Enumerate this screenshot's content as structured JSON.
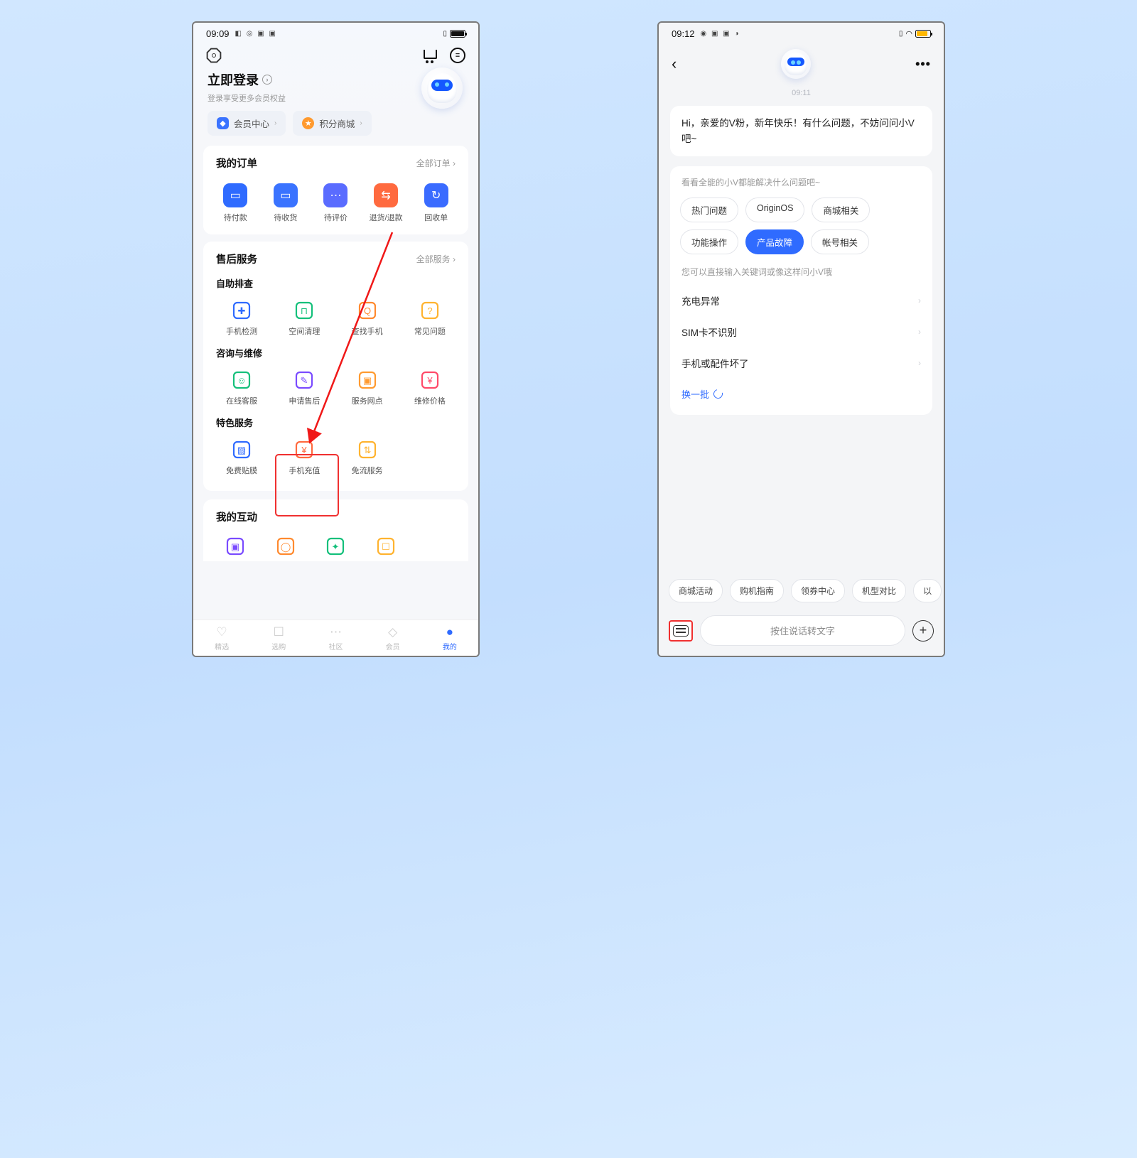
{
  "screen1": {
    "status": {
      "time": "09:09",
      "glyphs": "◧ ◎ ▣ ▣"
    },
    "login": {
      "title": "立即登录",
      "sub": "登录享受更多会员权益"
    },
    "pills": [
      {
        "label": "会员中心",
        "color": "#3a73ff"
      },
      {
        "label": "积分商城",
        "color": "#ff9a2f"
      }
    ],
    "orders": {
      "title": "我的订单",
      "all": "全部订单 ›",
      "items": [
        {
          "label": "待付款",
          "color": "#2f6bff"
        },
        {
          "label": "待收货",
          "color": "#3a73ff"
        },
        {
          "label": "待评价",
          "color": "#5a6cff"
        },
        {
          "label": "退货/退款",
          "color": "#ff6a3f"
        },
        {
          "label": "回收单",
          "color": "#3a6bff"
        }
      ]
    },
    "service": {
      "title": "售后服务",
      "all": "全部服务 ›",
      "g1": {
        "head": "自助排查",
        "items": [
          {
            "label": "手机检测",
            "color": "#2f6bff"
          },
          {
            "label": "空间清理",
            "color": "#14c07b"
          },
          {
            "label": "查找手机",
            "color": "#ff8a2f"
          },
          {
            "label": "常见问题",
            "color": "#ffb32f"
          }
        ]
      },
      "g2": {
        "head": "咨询与维修",
        "items": [
          {
            "label": "在线客服",
            "color": "#14c07b"
          },
          {
            "label": "申请售后",
            "color": "#7a4bff"
          },
          {
            "label": "服务网点",
            "color": "#ff9a2f"
          },
          {
            "label": "维修价格",
            "color": "#ff4b6a"
          }
        ]
      },
      "g3": {
        "head": "特色服务",
        "items": [
          {
            "label": "免费贴膜",
            "color": "#2f6bff"
          },
          {
            "label": "手机充值",
            "color": "#ff6a3f"
          },
          {
            "label": "免流服务",
            "color": "#ffb32f"
          }
        ]
      }
    },
    "interact": {
      "title": "我的互动",
      "items": [
        {
          "color": "#7a4bff"
        },
        {
          "color": "#ff8a2f"
        },
        {
          "color": "#14c07b"
        },
        {
          "color": "#ffb32f"
        }
      ]
    },
    "nav": [
      {
        "label": "精选"
      },
      {
        "label": "选购"
      },
      {
        "label": "社区"
      },
      {
        "label": "会员"
      },
      {
        "label": "我的"
      }
    ]
  },
  "screen2": {
    "status": {
      "time": "09:12",
      "glyphs": "◉ ▣ ▣ ◑"
    },
    "ts": "09:11",
    "greeting": "Hi，亲爱的V粉，新年快乐！有什么问题，不妨问问小V吧~",
    "suggHead": "看看全能的小V都能解决什么问题吧~",
    "chips": [
      "热门问题",
      "OriginOS",
      "商城相关",
      "功能操作",
      "产品故障",
      "帐号相关"
    ],
    "chipActive": 4,
    "hint": "您可以直接输入关键词或像这样问小V哦",
    "questions": [
      "充电异常",
      "SIM卡不识别",
      "手机或配件坏了"
    ],
    "refresh": "换一批",
    "quick": [
      "商城活动",
      "购机指南",
      "领券中心",
      "机型对比",
      "以"
    ],
    "input": "按住说话转文字"
  }
}
